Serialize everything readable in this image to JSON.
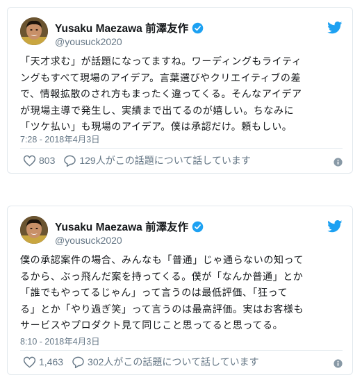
{
  "colors": {
    "brand_blue": "#1da1f2",
    "text": "#14171a",
    "secondary_text": "#657786",
    "border": "#e1e8ed"
  },
  "tweets": [
    {
      "author": {
        "name": "Yusaku Maezawa 前澤友作",
        "handle": "@yousuck2020",
        "verified": true,
        "avatar_icon": "avatar-photo",
        "verified_icon": "verified-badge-icon"
      },
      "text_lines": [
        "「天才求む」が話題になってますね。ワーディングもライティ",
        "ングもすべて現場のアイデア。言葉選びやクリエイティブの差",
        "で、情報拡散のされ方もまったく違ってくる。そんなアイデア",
        "が現場主導で発生し、実績まで出てるのが嬉しい。ちなみに",
        "「ツケ払い」も現場のアイデア。僕は承認だけ。頼もしい。"
      ],
      "timestamp": "7:28 - 2018年4月3日",
      "likes": "803",
      "conversation": "129人がこの話題について話しています",
      "icons": [
        "twitter-bird-icon",
        "heart-icon",
        "reply-bubble-icon",
        "info-icon"
      ]
    },
    {
      "author": {
        "name": "Yusaku Maezawa 前澤友作",
        "handle": "@yousuck2020",
        "verified": true,
        "avatar_icon": "avatar-photo",
        "verified_icon": "verified-badge-icon"
      },
      "text_lines": [
        "僕の承認案件の場合、みんなも「普通」じゃ通らないの知って",
        "るから、ぶっ飛んだ案を持ってくる。僕が「なんか普通」とか",
        "「誰でもやってるじゃん」って言うのは最低評価、「狂って",
        "る」とか「やり過ぎ笑」って言うのは最高評価。実はお客様も",
        "サービスやプロダクト見て同じこと思ってると思ってる。"
      ],
      "timestamp": "8:10 - 2018年4月3日",
      "likes": "1,463",
      "conversation": "302人がこの話題について話しています",
      "icons": [
        "twitter-bird-icon",
        "heart-icon",
        "reply-bubble-icon",
        "info-icon"
      ]
    }
  ]
}
